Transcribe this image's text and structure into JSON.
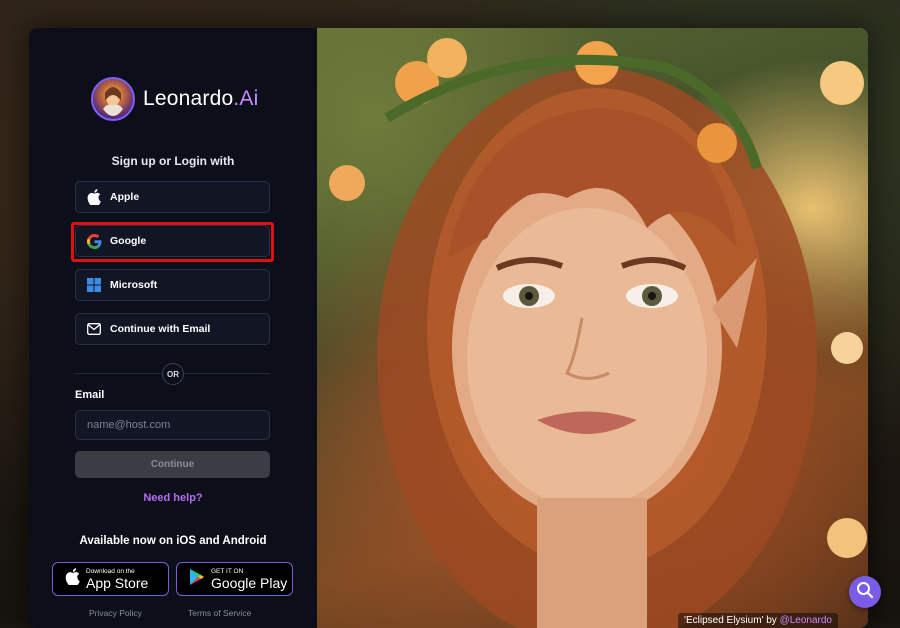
{
  "brand": {
    "name": "Leonardo",
    "suffix": ".Ai"
  },
  "auth": {
    "heading": "Sign up or Login with",
    "providers": [
      {
        "label": "Apple",
        "icon": "apple-icon"
      },
      {
        "label": "Google",
        "icon": "google-icon"
      },
      {
        "label": "Microsoft",
        "icon": "microsoft-icon"
      },
      {
        "label": "Continue with Email",
        "icon": "mail-icon"
      }
    ],
    "divider_label": "OR",
    "email_label": "Email",
    "email_placeholder": "name@host.com",
    "email_value": "",
    "continue_label": "Continue",
    "help_label": "Need help?"
  },
  "apps": {
    "heading": "Available now on iOS and Android",
    "app_store": {
      "small": "Download on the",
      "big": "App Store"
    },
    "google_play": {
      "small": "GET IT ON",
      "big": "Google Play"
    }
  },
  "footer": {
    "privacy": "Privacy Policy",
    "terms": "Terms of Service"
  },
  "image_caption": {
    "title": "'Eclipsed Elysium' by ",
    "author": "@Leonardo"
  },
  "colors": {
    "accent_purple": "#c78bff",
    "highlight_red": "#e01010",
    "panel_bg": "#0c0f1a"
  }
}
